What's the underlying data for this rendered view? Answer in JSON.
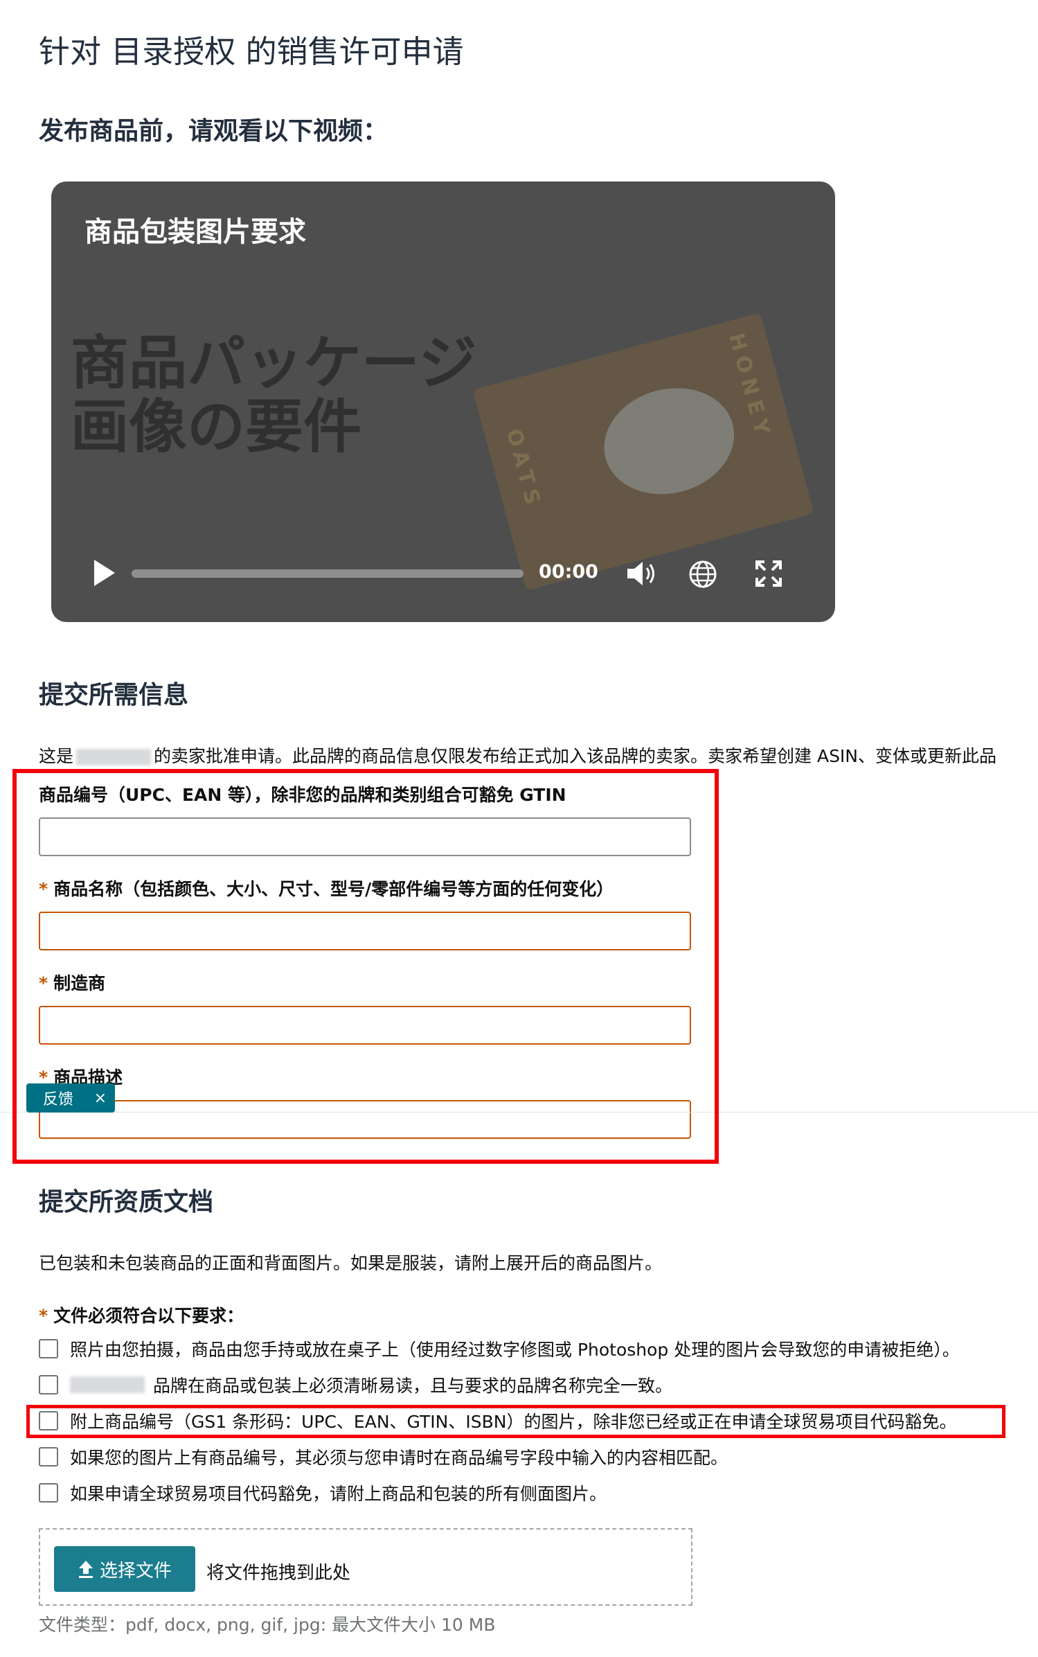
{
  "page": {
    "title": "针对 目录授权 的销售许可申请",
    "watch_heading": "发布商品前，请观看以下视频：",
    "info_heading": "提交所需信息",
    "docs_heading": "提交所资质文档"
  },
  "video": {
    "title": "商品包装图片要求",
    "thumbnail_text": "商品パッケージ\n画像の要件",
    "package_left": "OATS",
    "package_right": "HONEY",
    "time": "00:00",
    "progress": 0,
    "icons": [
      "play-icon",
      "volume-icon",
      "globe-icon",
      "fullscreen-icon"
    ]
  },
  "intro": {
    "before": "这是",
    "after": "的卖家批准申请。此品牌的商品信息仅限发布给正式加入该品牌的卖家。卖家希望创建 ASIN、变体或更新此品"
  },
  "fields": [
    {
      "label": "商品编号（UPC、EAN 等），除非您的品牌和类别组合可豁免 GTIN",
      "required": false,
      "value": ""
    },
    {
      "label": "商品名称（包括颜色、大小、尺寸、型号/零部件编号等方面的任何变化）",
      "required": true,
      "value": ""
    },
    {
      "label": "制造商",
      "required": true,
      "value": ""
    },
    {
      "label": "商品描述",
      "required": true,
      "value": ""
    }
  ],
  "required_mark": "*",
  "feedback": {
    "label": "反馈",
    "close": "×"
  },
  "docs": {
    "description": "已包装和未包装商品的正面和背面图片。如果是服装，请附上展开后的商品图片。",
    "requirements_label": "文件必须符合以下要求：",
    "checkboxes": [
      "照片由您拍摄，商品由您手持或放在桌子上（使用经过数字修图或 Photoshop 处理的图片会导致您的申请被拒绝）。",
      "品牌在商品或包装上必须清晰易读，且与要求的品牌名称完全一致。",
      "附上商品编号（GS1 条形码：UPC、EAN、GTIN、ISBN）的图片，除非您已经或正在申请全球贸易项目代码豁免。",
      "如果您的图片上有商品编号，其必须与您申请时在商品编号字段中输入的内容相匹配。",
      "如果申请全球贸易项目代码豁免，请附上商品和包装的所有侧面图片。"
    ]
  },
  "upload": {
    "button_label": "选择文件",
    "drop_text": "将文件拖拽到此处",
    "file_types": "文件类型：pdf, docx, png, gif, jpg: 最大文件大小 10 MB"
  },
  "colors": {
    "accent": "#007185",
    "button": "#1b7d8d",
    "required": "#c45500",
    "highlight": "#f40009"
  }
}
